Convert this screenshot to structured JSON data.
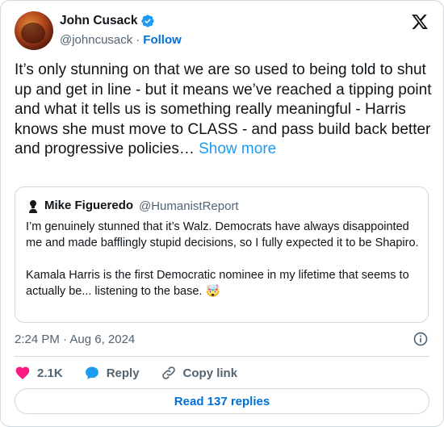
{
  "author": {
    "display_name": "John Cusack",
    "handle": "@johncusack",
    "separator": "·",
    "follow_label": "Follow",
    "verified": true
  },
  "tweet": {
    "text": "It’s only stunning on that we are so used to being told to shut up and get in line -  but it means we’ve reached a tipping point  and what it tells  us is something  really meaningful - Harris knows she must move to CLASS  -  and pass build back better and progressive policies… ",
    "show_more": "Show more"
  },
  "quoted_tweet": {
    "display_name": "Mike Figueredo",
    "handle": "@HumanistReport",
    "paragraphs": [
      "I’m genuinely stunned that it’s Walz. Democrats have always disappointed me and made bafflingly stupid decisions, so I fully expected it to be Shapiro.",
      "Kamala Harris is the first Democratic nominee in my lifetime that seems to actually be... listening to the base. 🤯"
    ]
  },
  "timestamp": "2:24 PM · Aug 6, 2024",
  "actions": {
    "like_count": "2.1K",
    "reply_label": "Reply",
    "copy_link_label": "Copy link"
  },
  "read_replies_label": "Read 137 replies",
  "colors": {
    "accent": "#1d9bf0",
    "link": "#006fd6",
    "like": "#f91880",
    "secondary_text": "#536471",
    "border": "#cfd9de"
  },
  "icons": {
    "verified": "verified-badge-icon",
    "logo": "x-logo-icon",
    "info": "info-icon",
    "like": "heart-icon",
    "reply": "speech-bubble-icon",
    "copy_link": "link-icon"
  }
}
